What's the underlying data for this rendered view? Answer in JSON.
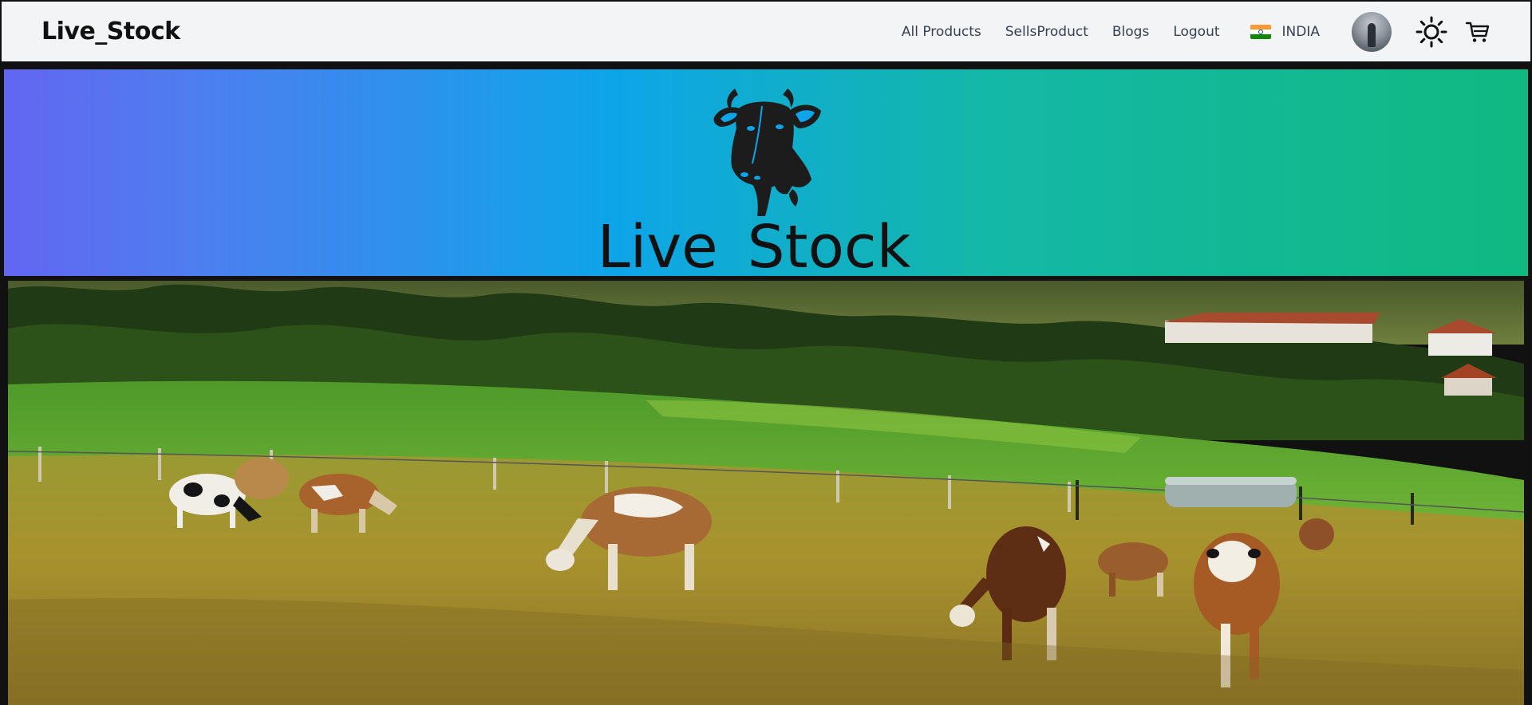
{
  "navbar": {
    "brand": "Live_Stock",
    "links": [
      {
        "label": "All Products"
      },
      {
        "label": "SellsProduct"
      },
      {
        "label": "Blogs"
      },
      {
        "label": "Logout"
      }
    ],
    "region": {
      "label": "INDIA",
      "flag": "india-flag-icon"
    },
    "icons": {
      "theme": "sun-icon",
      "cart": "cart-icon",
      "avatar": "avatar"
    }
  },
  "banner": {
    "title": "Live_Stock",
    "logo_icon": "cow-head-icon",
    "gradient": [
      "#6366f1",
      "#0ea5e9",
      "#10b981"
    ]
  },
  "hero_image": {
    "subject": "cows-grazing-photo"
  },
  "colors": {
    "navbar_bg": "#f3f4f6",
    "text_dark": "#111111",
    "link": "#374151"
  }
}
